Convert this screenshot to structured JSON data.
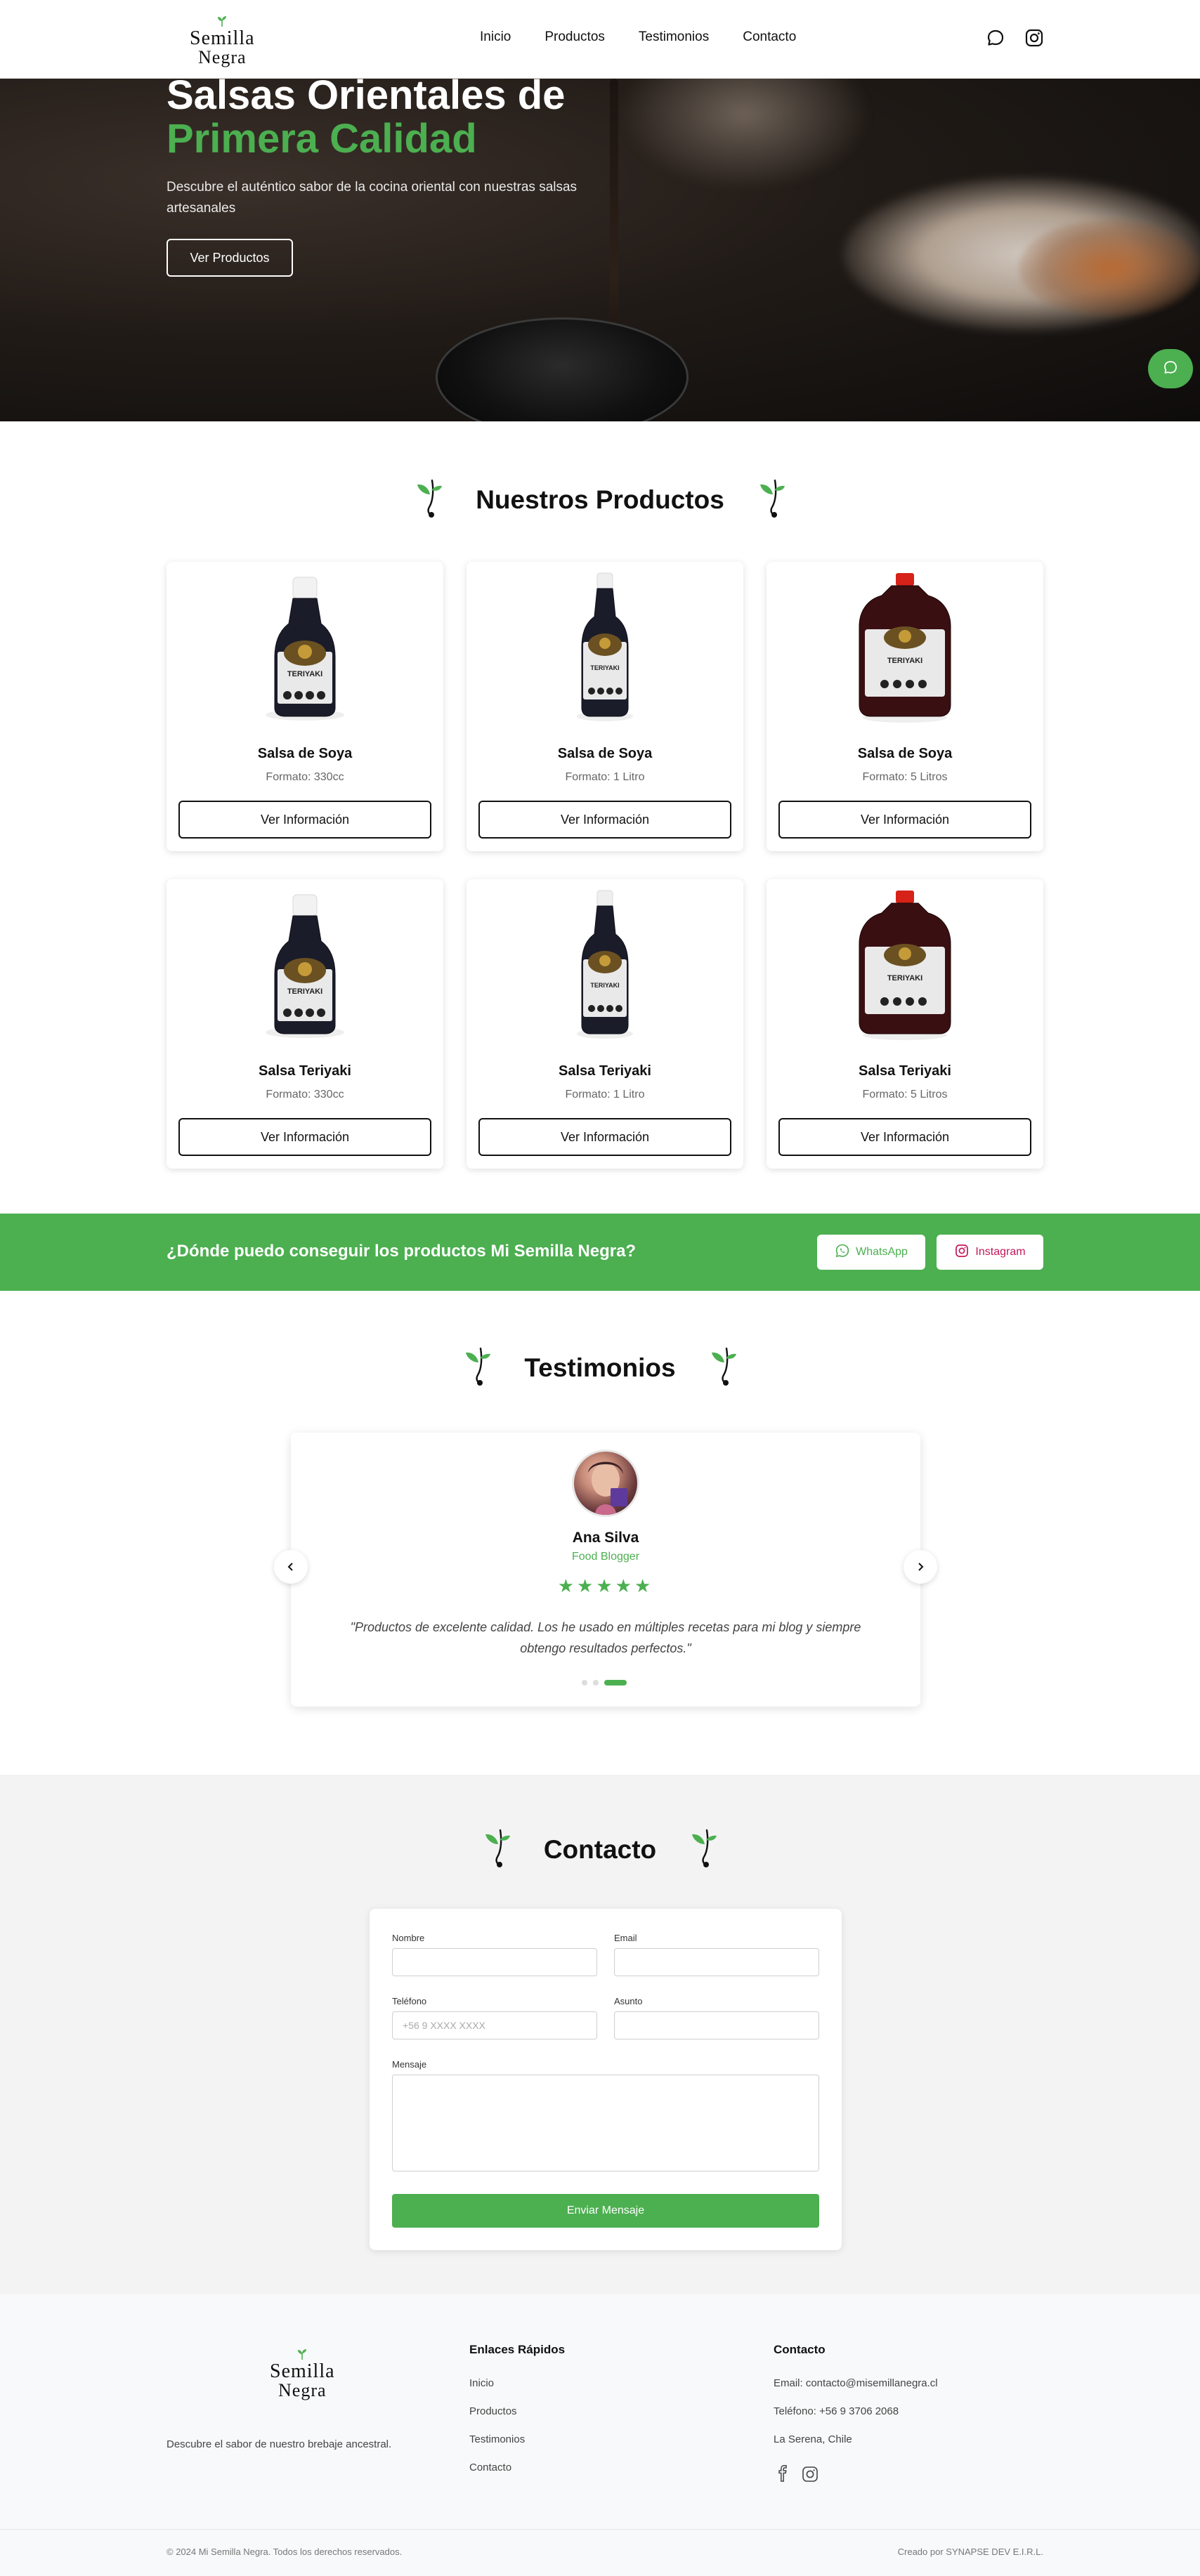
{
  "brand": {
    "logo_line1": "Semilla",
    "logo_line2": "Negra"
  },
  "nav": {
    "links": [
      "Inicio",
      "Productos",
      "Testimonios",
      "Contacto"
    ],
    "icons": [
      "chat-icon",
      "instagram-icon"
    ]
  },
  "hero": {
    "title_line1": "Salsas Orientales de",
    "title_line2": "Primera Calidad",
    "subtitle": "Descubre el auténtico sabor de la cocina oriental con nuestras salsas artesanales",
    "button": "Ver Productos"
  },
  "products": {
    "heading": "Nuestros Productos",
    "button_label": "Ver Información",
    "items": [
      {
        "name": "Salsa de Soya",
        "format": "Formato: 330cc",
        "bottle": "small"
      },
      {
        "name": "Salsa de Soya",
        "format": "Formato: 1 Litro",
        "bottle": "medium"
      },
      {
        "name": "Salsa de Soya",
        "format": "Formato: 5 Litros",
        "bottle": "jug"
      },
      {
        "name": "Salsa Teriyaki",
        "format": "Formato: 330cc",
        "bottle": "small"
      },
      {
        "name": "Salsa Teriyaki",
        "format": "Formato: 1 Litro",
        "bottle": "medium"
      },
      {
        "name": "Salsa Teriyaki",
        "format": "Formato: 5 Litros",
        "bottle": "jug"
      }
    ],
    "label_text": "TERIYAKI"
  },
  "band": {
    "question": "¿Dónde puedo conseguir los productos Mi Semilla Negra?",
    "whatsapp": "WhatsApp",
    "instagram": "Instagram"
  },
  "testimonials": {
    "heading": "Testimonios",
    "name": "Ana Silva",
    "role": "Food Blogger",
    "stars": "★★★★★",
    "rating": 5,
    "quote": "\"Productos de excelente calidad. Los he usado en múltiples recetas para mi blog y siempre obtengo resultados perfectos.\"",
    "prev": "‹",
    "next": "›",
    "active_dot": 2
  },
  "contact": {
    "heading": "Contacto",
    "name_label": "Nombre",
    "email_label": "Email",
    "phone_label": "Teléfono",
    "phone_placeholder": "+56 9 XXXX XXXX",
    "subject_label": "Asunto",
    "message_label": "Mensaje",
    "submit": "Enviar Mensaje"
  },
  "footer": {
    "tagline": "Descubre el sabor de nuestro brebaje ancestral.",
    "links_title": "Enlaces Rápidos",
    "links": [
      "Inicio",
      "Productos",
      "Testimonios",
      "Contacto"
    ],
    "contact_title": "Contacto",
    "email": "Email: contacto@misemillanegra.cl",
    "phone": "Teléfono: +56 9 3706 2068",
    "location": "La Serena, Chile",
    "social_icons": [
      "facebook-icon",
      "instagram-icon"
    ],
    "copyright": "© 2024 Mi Semilla Negra. Todos los derechos reservados.",
    "credit": "Creado por SYNAPSE DEV E.I.R.L."
  },
  "colors": {
    "accent": "#4caf50",
    "dark": "#111111",
    "band": "#4caf50"
  }
}
